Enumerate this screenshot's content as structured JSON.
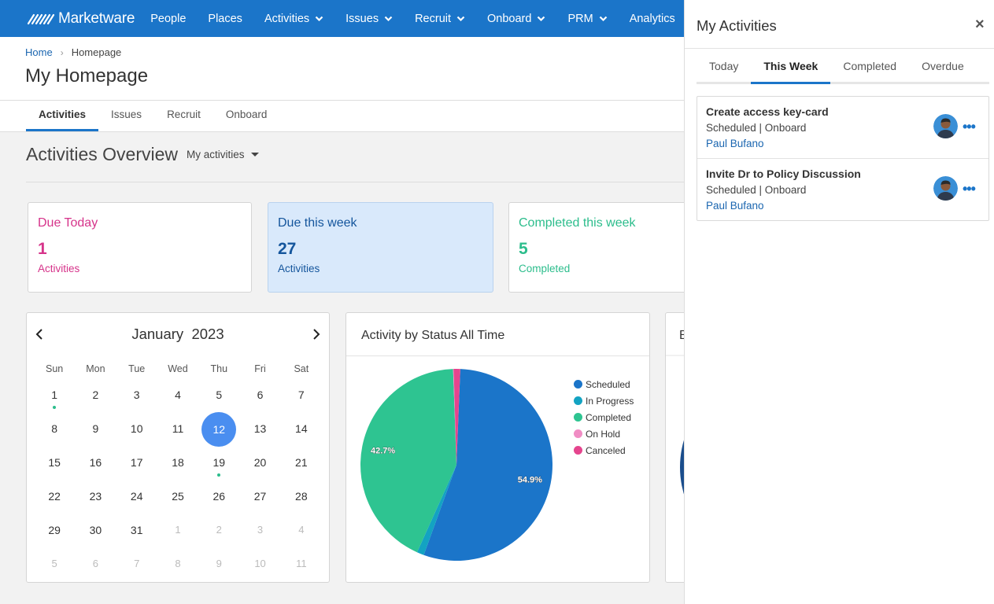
{
  "app": {
    "brand": "Marketware"
  },
  "nav": {
    "items": [
      {
        "label": "People",
        "dropdown": false
      },
      {
        "label": "Places",
        "dropdown": false
      },
      {
        "label": "Activities",
        "dropdown": true
      },
      {
        "label": "Issues",
        "dropdown": true
      },
      {
        "label": "Recruit",
        "dropdown": true
      },
      {
        "label": "Onboard",
        "dropdown": true
      },
      {
        "label": "PRM",
        "dropdown": true
      },
      {
        "label": "Analytics",
        "dropdown": false
      }
    ]
  },
  "breadcrumb": {
    "home": "Home",
    "separator": "›",
    "current": "Homepage"
  },
  "page": {
    "title": "My Homepage"
  },
  "subtabs": [
    "Activities",
    "Issues",
    "Recruit",
    "Onboard"
  ],
  "overview": {
    "title": "Activities Overview",
    "filter": "My activities"
  },
  "cards": [
    {
      "title": "Due Today",
      "count": "1",
      "sub": "Activities"
    },
    {
      "title": "Due this week",
      "count": "27",
      "sub": "Activities"
    },
    {
      "title": "Completed this week",
      "count": "5",
      "sub": "Completed"
    }
  ],
  "calendar": {
    "month": "January",
    "year": "2023",
    "weekdays": [
      "Sun",
      "Mon",
      "Tue",
      "Wed",
      "Thu",
      "Fri",
      "Sat"
    ],
    "weeks": [
      [
        "1",
        "2",
        "3",
        "4",
        "5",
        "6",
        "7"
      ],
      [
        "8",
        "9",
        "10",
        "11",
        "12",
        "13",
        "14"
      ],
      [
        "15",
        "16",
        "17",
        "18",
        "19",
        "20",
        "21"
      ],
      [
        "22",
        "23",
        "24",
        "25",
        "26",
        "27",
        "28"
      ],
      [
        "29",
        "30",
        "31",
        "1",
        "2",
        "3",
        "4"
      ],
      [
        "5",
        "6",
        "7",
        "8",
        "9",
        "10",
        "11"
      ]
    ],
    "today": "12",
    "event_days": [
      "1",
      "19"
    ]
  },
  "chart_data": {
    "type": "pie",
    "title": "Activity by Status All Time",
    "categories": [
      "Scheduled",
      "In Progress",
      "Completed",
      "On Hold",
      "Canceled"
    ],
    "values": [
      54.9,
      1.2,
      42.7,
      0.1,
      1.1
    ],
    "labels": [
      "54.9%",
      "",
      "42.7%",
      "",
      ""
    ],
    "colors": [
      "#1b75c9",
      "#13a3c2",
      "#2ec491",
      "#f08dc4",
      "#e5458e"
    ],
    "legend": "right"
  },
  "panel3": {
    "title": "B"
  },
  "drawer": {
    "title": "My Activities",
    "close": "×",
    "tabs": [
      "Today",
      "This Week",
      "Completed",
      "Overdue"
    ],
    "active_tab": "This Week",
    "items": [
      {
        "title": "Create access key-card",
        "status": "Scheduled | Onboard",
        "assignee": "Paul Bufano"
      },
      {
        "title": "Invite Dr to Policy Discussion",
        "status": "Scheduled | Onboard",
        "assignee": "Paul Bufano"
      }
    ]
  },
  "icons": {
    "logo": "marketware-logo-icon",
    "close": "close-icon",
    "more": "more-dots-icon",
    "avatar": "user-avatar-icon",
    "prev": "chevron-left-icon",
    "next": "chevron-right-icon"
  }
}
